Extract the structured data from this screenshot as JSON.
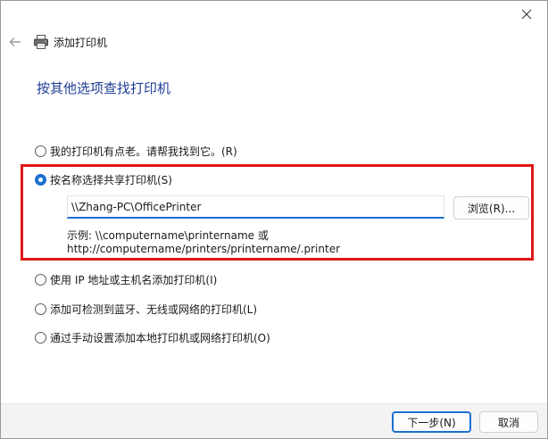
{
  "window": {
    "title": "添加打印机",
    "close_icon": "close-icon",
    "back_icon": "back-arrow-icon",
    "title_icon": "printer-icon"
  },
  "heading": "按其他选项查找打印机",
  "options": [
    {
      "label": "我的打印机有点老。请帮我找到它。(R)",
      "checked": false
    },
    {
      "label": "按名称选择共享打印机(S)",
      "checked": true
    },
    {
      "label": "使用 IP 地址或主机名添加打印机(I)",
      "checked": false
    },
    {
      "label": "添加可检测到蓝牙、无线或网络的打印机(L)",
      "checked": false
    },
    {
      "label": "通过手动设置添加本地打印机或网络打印机(O)",
      "checked": false
    }
  ],
  "shared_printer": {
    "value": "\\\\Zhang-PC\\OfficePrinter",
    "browse_label": "浏览(R)...",
    "example_line1": "示例: \\\\computername\\printername 或",
    "example_line2": "http://computername/printers/printername/.printer"
  },
  "footer": {
    "next_label": "下一步(N)",
    "cancel_label": "取消"
  },
  "colors": {
    "accent": "#1d6fd1",
    "heading": "#1f3e95",
    "highlight": "#e01616"
  }
}
